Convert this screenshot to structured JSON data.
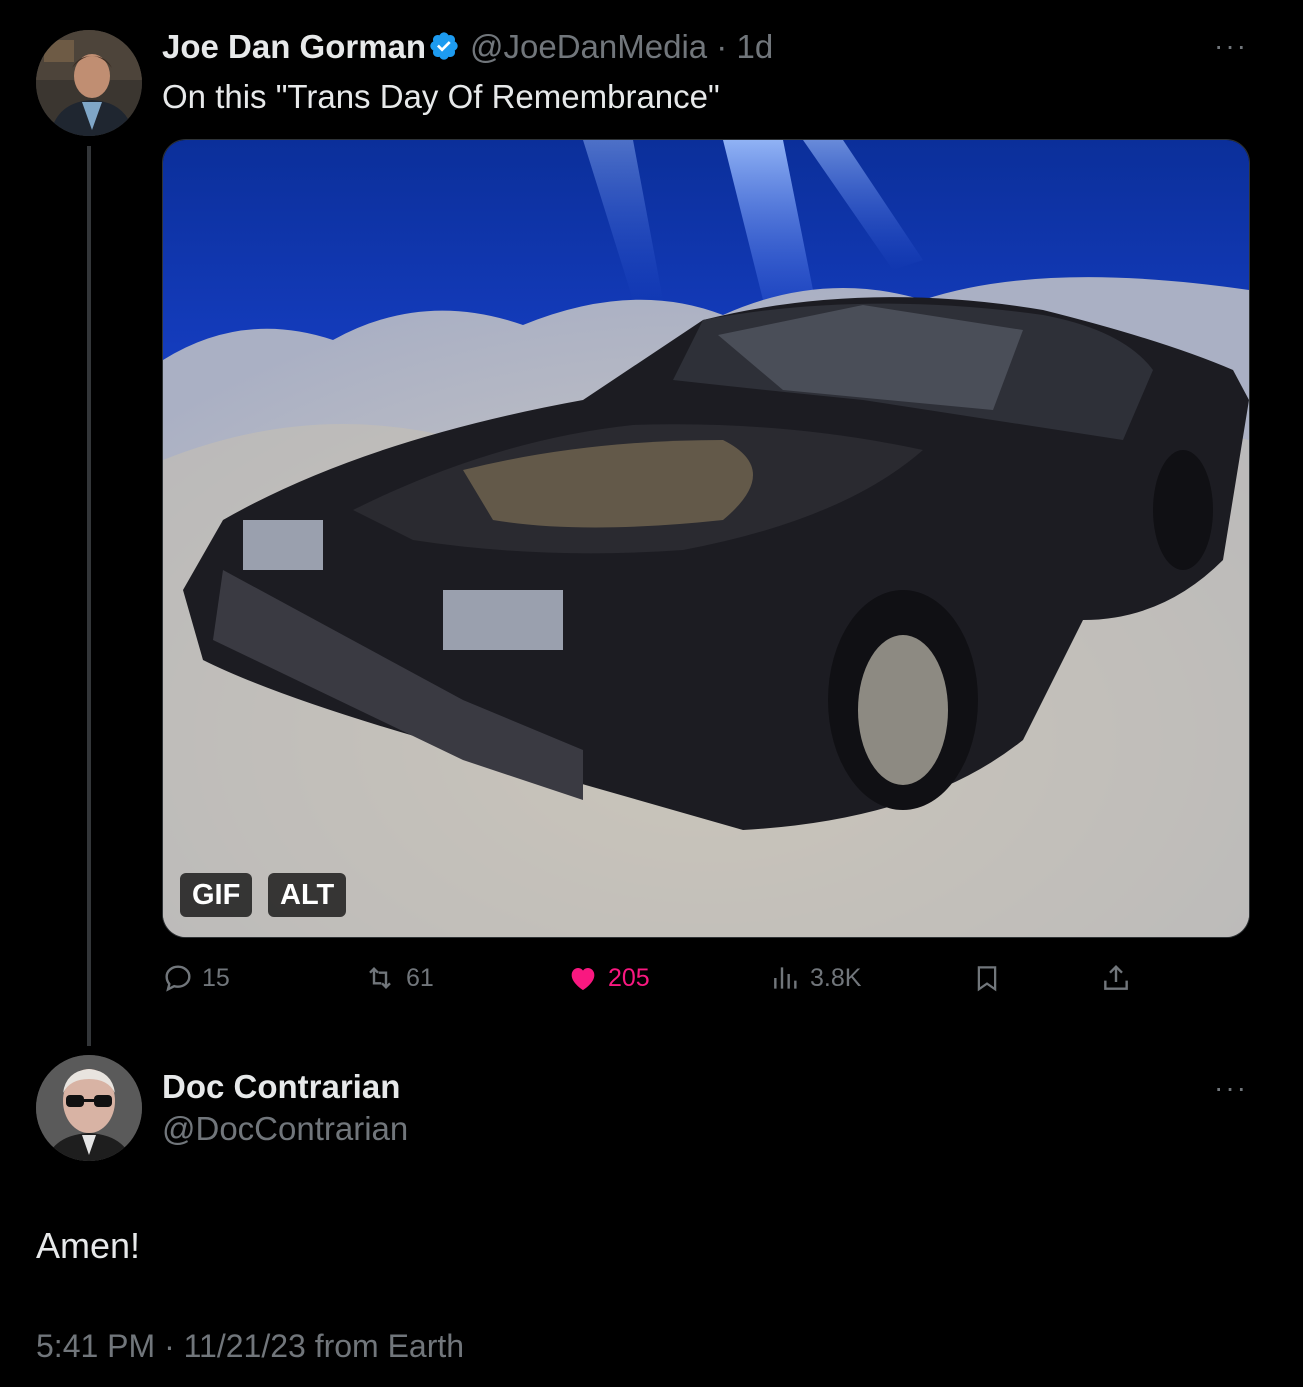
{
  "tweet": {
    "author_name": "Joe Dan Gorman",
    "author_handle": "@JoeDanMedia",
    "separator": "·",
    "time": "1d",
    "text": "On this \"Trans Day Of Remembrance\"",
    "media": {
      "badge_gif": "GIF",
      "badge_alt": "ALT"
    },
    "actions": {
      "replies": "15",
      "reposts": "61",
      "likes": "205",
      "views": "3.8K"
    }
  },
  "reply": {
    "author_name": "Doc Contrarian",
    "author_handle": "@DocContrarian",
    "text": "Amen!",
    "meta": "5:41 PM · 11/21/23 from Earth"
  },
  "more_glyph": "···",
  "colors": {
    "background": "#000000",
    "text": "#e7e9ea",
    "muted": "#71767b",
    "like": "#f91880",
    "verified": "#1d9bf0"
  }
}
